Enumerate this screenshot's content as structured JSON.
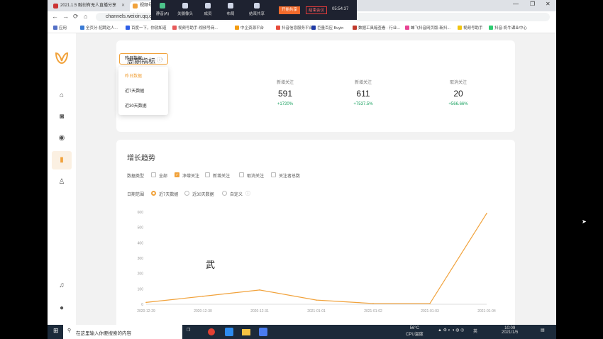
{
  "browser": {
    "tabs": [
      {
        "label": "2021.1.5 融创有无人直播分享"
      },
      {
        "label": "视频号助手"
      }
    ],
    "window_controls": [
      "—",
      "❐",
      "✕"
    ],
    "nav": [
      "←",
      "→",
      "⟳",
      "⌂"
    ],
    "url": "channels.weixin.qq.com/statistic/follower",
    "bookmarks": [
      {
        "label": "应用",
        "color": "#5470c6"
      },
      {
        "label": "全页分-招聘达人...",
        "color": "#3a7bd5"
      },
      {
        "label": "百度一下，你就知道",
        "color": "#2e5ee6"
      },
      {
        "label": "视频号助手-视频号商...",
        "color": "#e75a5a"
      },
      {
        "label": "中企资源平台",
        "color": "#f39c12"
      },
      {
        "label": "抖音信息服务平台",
        "color": "#e74c3c"
      },
      {
        "label": "巨量百应 Buyin",
        "color": "#1f3aa6"
      },
      {
        "label": "数据工具箱查看 · 行业...",
        "color": "#c0392b"
      },
      {
        "label": "蝉飞抖音网页版-新抖...",
        "color": "#e84393"
      },
      {
        "label": "视频号助手",
        "color": "#f1c40f"
      },
      {
        "label": "抖音-奶牛课业中心",
        "color": "#2ecc71"
      }
    ]
  },
  "meeting": {
    "items": [
      "静音(A)",
      "关摄像头",
      "成员",
      "布局",
      "结束共享"
    ],
    "share_btn": "开始共享",
    "end_btn": "结束会议",
    "time": "05:54:37",
    "colors": {
      "share": "#f26a2b",
      "end": "#e23a3a"
    }
  },
  "sidebar": {
    "logo_color": "#f1a23b",
    "items": [
      "home-icon",
      "camera-icon",
      "live-icon",
      "stats-icon",
      "user-icon"
    ],
    "bottom": [
      "bell-icon",
      "avatar-icon"
    ]
  },
  "period": {
    "title": "周期指标",
    "info_icon": "ⓘ",
    "select_value": "昨日数据",
    "options": [
      "昨日数据",
      "近7天数据",
      "近30天数据"
    ],
    "metrics": [
      {
        "label": "新增关注",
        "value": "591",
        "change": "+1720%"
      },
      {
        "label": "新增关注",
        "value": "611",
        "change": "+7537.5%"
      },
      {
        "label": "取消关注",
        "value": "20",
        "change": "+566.66%"
      }
    ]
  },
  "growth": {
    "title": "增长趋势",
    "type_label": "数据类型",
    "types": [
      {
        "label": "全部",
        "checked": false
      },
      {
        "label": "净增关注",
        "checked": true
      },
      {
        "label": "新增关注",
        "checked": false
      },
      {
        "label": "取消关注",
        "checked": false
      },
      {
        "label": "关注者总数",
        "checked": false
      }
    ],
    "range_label": "日期范围",
    "ranges": [
      {
        "label": "近7天数据",
        "on": true
      },
      {
        "label": "近30天数据",
        "on": false
      },
      {
        "label": "自定义",
        "on": false
      }
    ],
    "watermark": "武"
  },
  "chart_data": {
    "type": "line",
    "x": [
      "2020-12-29",
      "2020-12-30",
      "2020-12-31",
      "2021-01-01",
      "2021-01-02",
      "2021-01-03",
      "2021-01-04"
    ],
    "series": [
      {
        "values": [
          12,
          52,
          93,
          27,
          5,
          5,
          591
        ]
      }
    ],
    "ylim": [
      0,
      600
    ],
    "yticks": [
      0,
      100,
      200,
      300,
      400,
      500,
      600
    ],
    "color": "#f1a23b",
    "grid": false
  },
  "taskbar": {
    "search": "在这里输入你要搜索的内容",
    "weather": "56°C",
    "weather_sub": "CPU温度",
    "lang": "英",
    "time": "10:09",
    "date": "2021/1/5"
  }
}
